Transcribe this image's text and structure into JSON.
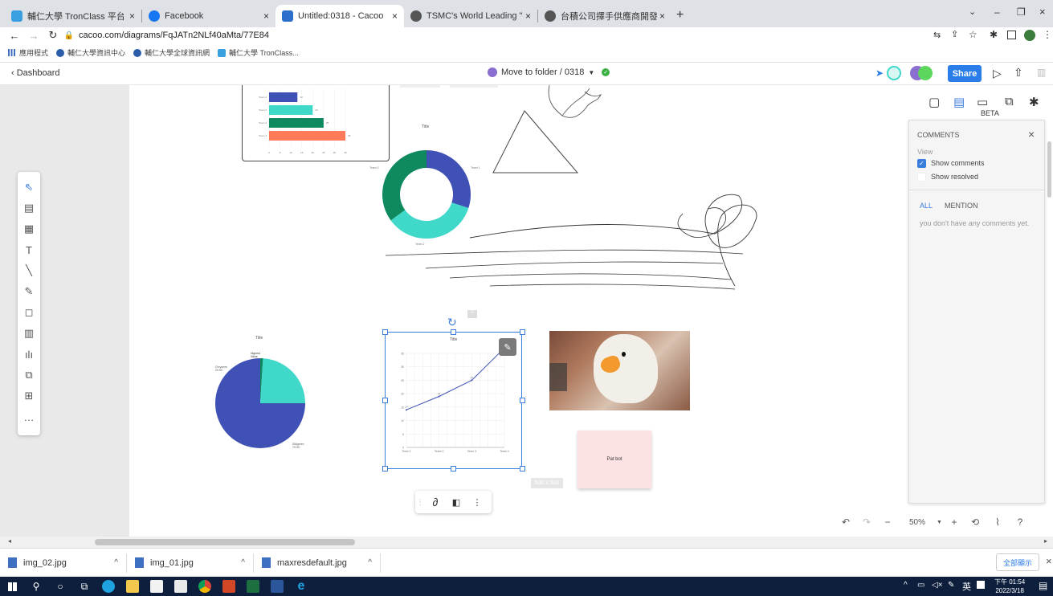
{
  "browser": {
    "tabs": [
      {
        "label": "輔仁大學 TronClass 平台",
        "color": "#3aa0e0"
      },
      {
        "label": "Facebook",
        "color": "#1877f2"
      },
      {
        "label": "Untitled:0318 - Cacoo",
        "color": "#2c6ecb"
      },
      {
        "label": "TSMC's World Leading \"Ultra L",
        "color": "#555555"
      },
      {
        "label": "台積公司擇手供應商開發「漫岸",
        "color": "#555555"
      }
    ],
    "new_tab": "+",
    "url": "cacoo.com/diagrams/FqJATn2NLf40aMta/77E84",
    "bookmarks": [
      "應用程式",
      "輔仁大學資訊中心",
      "輔仁大學全球資訊網",
      "輔仁大學 TronClass..."
    ]
  },
  "app": {
    "back_label": "‹ Dashboard",
    "folder_label": "Move to folder / 0318",
    "share_label": "Share",
    "beta_label": "BETA"
  },
  "comments": {
    "title": "COMMENTS",
    "view_label": "View",
    "show_comments": "Show comments",
    "show_resolved": "Show resolved",
    "tab_all": "ALL",
    "tab_mention": "MENTION",
    "empty": "you don't have any comments yet.",
    "accent": "#3b7ddd"
  },
  "canvas_items": {
    "bar_chart": {
      "categories": [
        "Team 1",
        "Team 2",
        "Team 3",
        "Team 4"
      ],
      "values": [
        13,
        20,
        25,
        35
      ],
      "colors": [
        "#3f51b5",
        "#40d9c9",
        "#0f8a5f",
        "#ff7a59"
      ],
      "ticks": [
        "0",
        "5",
        "10",
        "15",
        "20",
        "25",
        "30",
        "35"
      ]
    },
    "donut_title": "Title",
    "donut_labels": [
      "Team 1",
      "Team 2",
      "Team 3"
    ],
    "pie_title": "Title",
    "pie_labels": [
      "Highest\nValue",
      "Chrysene\n20.00",
      "Silkgreen\n70.00"
    ],
    "line_title": "Title",
    "line_y_ticks": [
      "35",
      "30",
      "25",
      "20",
      "15",
      "10",
      "5",
      "0"
    ],
    "line_x_ticks": [
      "Team 1",
      "Team 2",
      "Team 3",
      "Team 4"
    ],
    "size_badge": "500 x 500",
    "sticky_note": "Pat bot"
  },
  "chart_data": [
    {
      "type": "bar",
      "categories": [
        "Team 1",
        "Team 2",
        "Team 3",
        "Team 4"
      ],
      "values": [
        13,
        20,
        25,
        35
      ],
      "xlim": [
        0,
        35
      ]
    },
    {
      "type": "pie",
      "title": "Title",
      "categories": [
        "Team 1",
        "Team 2",
        "Team 3"
      ],
      "values": [
        30,
        35,
        35
      ]
    },
    {
      "type": "pie",
      "title": "Title",
      "categories": [
        "Highest Value",
        "Chrysene",
        "Silkgreen"
      ],
      "values": [
        1,
        24,
        75
      ]
    },
    {
      "type": "line",
      "title": "Title",
      "categories": [
        "Team 1",
        "Team 2",
        "Team 3",
        "Team 4"
      ],
      "values": [
        14,
        19,
        25,
        37
      ],
      "ylim": [
        0,
        35
      ]
    }
  ],
  "zoom": {
    "level": "50%"
  },
  "downloads": [
    {
      "name": "img_02.jpg"
    },
    {
      "name": "img_01.jpg"
    },
    {
      "name": "maxresdefault.jpg"
    }
  ],
  "downloads_show_all": "全部顯示",
  "taskbar": {
    "ime": "英",
    "time": "下午 01:54",
    "date": "2022/3/18"
  }
}
